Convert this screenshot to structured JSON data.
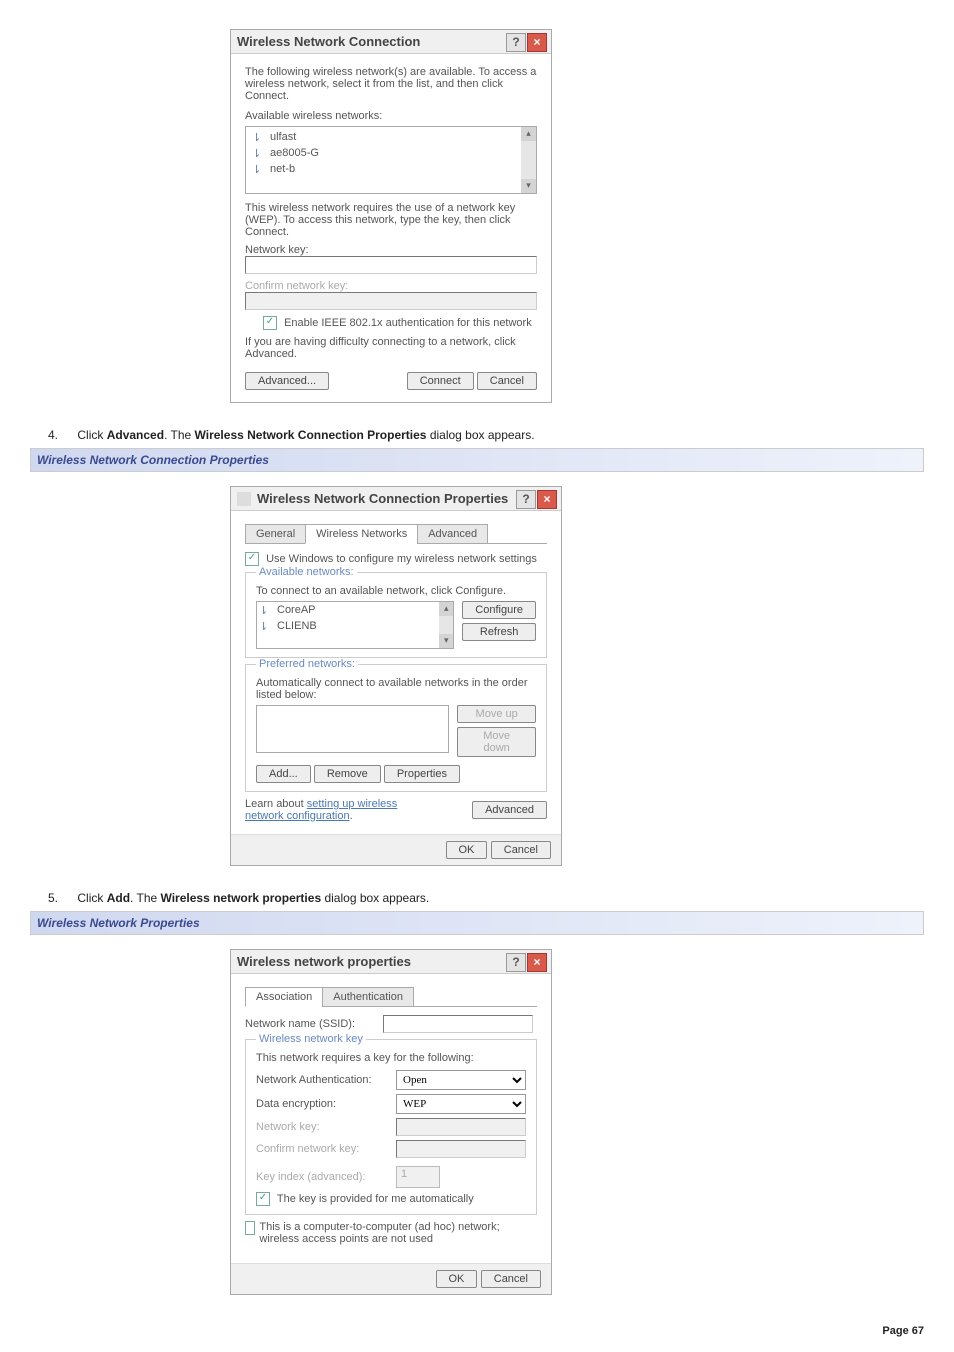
{
  "dlg1": {
    "title": "Wireless Network Connection",
    "intro": "The following wireless network(s) are available. To access a wireless network, select it from the list, and then click Connect.",
    "avail_label": "Available wireless networks:",
    "nets": [
      "ulfast",
      "ae8005-G",
      "net-b"
    ],
    "wep_note": "This wireless network requires the use of a network key (WEP). To access this network, type the key, then click Connect.",
    "netkey_label": "Network key:",
    "confkey_label": "Confirm network key:",
    "ieee_label": "Enable IEEE 802.1x authentication for this network",
    "adv_note": "If you are having difficulty connecting to a network, click Advanced.",
    "btn_adv": "Advanced...",
    "btn_conn": "Connect",
    "btn_cancel": "Cancel"
  },
  "step4": {
    "num": "4.",
    "text_a": "Click ",
    "text_b": "Advanced",
    "text_c": ". The ",
    "text_d": "Wireless Network Connection Properties",
    "text_e": " dialog box appears."
  },
  "head1": "Wireless Network Connection Properties",
  "dlg2": {
    "title": "Wireless Network Connection Properties",
    "tab_gen": "General",
    "tab_wn": "Wireless Networks",
    "tab_adv": "Advanced",
    "use_win": "Use Windows to configure my wireless network settings",
    "avail_legend": "Available networks:",
    "avail_hint": "To connect to an available network, click Configure.",
    "nets": [
      "CoreAP",
      "CLIENB"
    ],
    "btn_conf": "Configure",
    "btn_refresh": "Refresh",
    "pref_legend": "Preferred networks:",
    "pref_hint": "Automatically connect to available networks in the order listed below:",
    "btn_up": "Move up",
    "btn_down": "Move down",
    "btn_add": "Add...",
    "btn_rem": "Remove",
    "btn_prop": "Properties",
    "learn_a": "Learn about ",
    "learn_link": "setting up wireless network configuration",
    "btn_adv": "Advanced",
    "btn_ok": "OK",
    "btn_cancel": "Cancel"
  },
  "step5": {
    "num": "5.",
    "text_a": "Click ",
    "text_b": "Add",
    "text_c": ". The ",
    "text_d": "Wireless network properties",
    "text_e": " dialog box appears."
  },
  "head2": "Wireless Network Properties",
  "dlg3": {
    "title": "Wireless network properties",
    "tab_assoc": "Association",
    "tab_auth": "Authentication",
    "ssid_label": "Network name (SSID):",
    "key_legend": "Wireless network key",
    "req_note": "This network requires a key for the following:",
    "auth_label": "Network Authentication:",
    "auth_val": "Open",
    "enc_label": "Data encryption:",
    "enc_val": "WEP",
    "netkey_label": "Network key:",
    "confkey_label": "Confirm network key:",
    "idx_label": "Key index (advanced):",
    "idx_val": "1",
    "auto_key": "The key is provided for me automatically",
    "adhoc": "This is a computer-to-computer (ad hoc) network; wireless access points are not used",
    "btn_ok": "OK",
    "btn_cancel": "Cancel"
  },
  "page": "Page 67"
}
